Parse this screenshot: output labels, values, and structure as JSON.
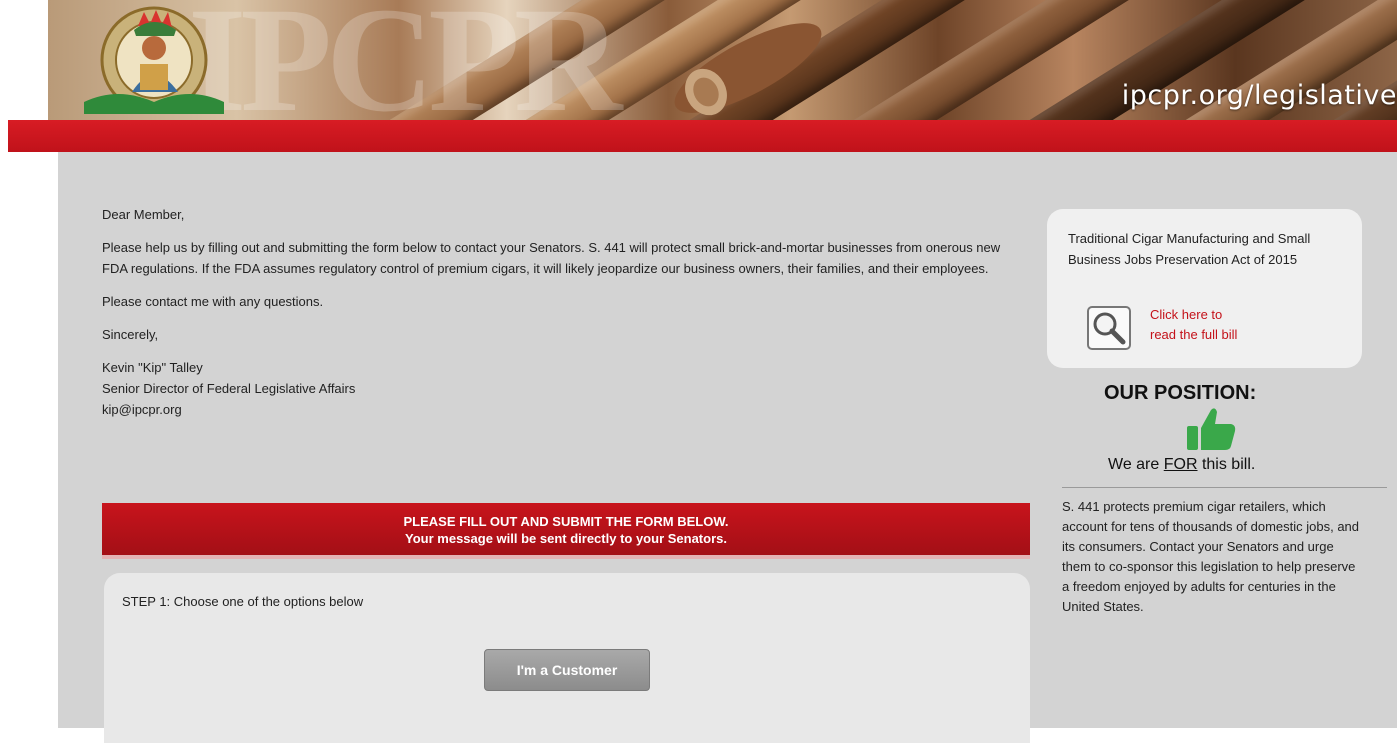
{
  "banner": {
    "logo_letters": "IPCPR",
    "url_text": "ipcpr.org/legislative",
    "logo_ring_text": "International Premium Cigar & Pipe Retailers Association"
  },
  "letter": {
    "salutation": "Dear Member,",
    "body1": "Please help us by filling out and submitting the form below to contact your Senators. S. 441 will protect small brick-and-mortar businesses from onerous new FDA regulations. If the FDA assumes regulatory control of premium cigars, it will likely jeopardize our business owners, their families, and their employees.",
    "body2": "Please contact me with any questions.",
    "closing": "Sincerely,",
    "sig_name": "Kevin \"Kip\" Talley",
    "sig_title": "Senior Director of Federal Legislative Affairs",
    "sig_email": "kip@ipcpr.org"
  },
  "form": {
    "header_line1": "PLEASE FILL OUT AND SUBMIT THE FORM BELOW.",
    "header_line2": "Your message will be sent directly to your Senators.",
    "step1_label": "STEP 1: Choose one of the options below",
    "customer_button": "I'm a Customer"
  },
  "sidebar": {
    "bill_title": "Traditional Cigar Manufacturing and Small Business Jobs Preservation Act of 2015",
    "bill_link_line1": "Click here to",
    "bill_link_line2": "read the full bill",
    "position_heading": "OUR POSITION:",
    "position_pre": "We are ",
    "position_for": "FOR",
    "position_post": " this bill.",
    "info_text": "S. 441 protects premium cigar retailers, which account for tens of thousands of domestic jobs, and its consumers. Contact your Senators and urge them to co-sponsor this legislation to help preserve a freedom enjoyed by adults for centuries in the United States."
  },
  "colors": {
    "brand_red": "#c8141c",
    "panel_gray": "#d3d3d3",
    "thumb_green": "#3aa84a",
    "link_red": "#c4121a"
  }
}
